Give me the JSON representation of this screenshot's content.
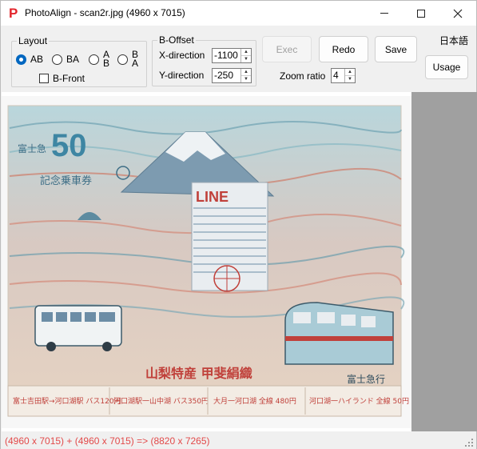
{
  "window": {
    "title": "PhotoAlign - scan2r.jpg (4960 x 7015)",
    "app_icon_letter": "P",
    "accent": "#e3242b"
  },
  "layout": {
    "legend": "Layout",
    "options": [
      {
        "label": "AB",
        "checked": true
      },
      {
        "label": "BA",
        "checked": false
      },
      {
        "label_top": "A",
        "label_bottom": "B",
        "checked": false
      },
      {
        "label_top": "B",
        "label_bottom": "A",
        "checked": false
      }
    ],
    "bfront_label": "B-Front",
    "bfront_checked": false
  },
  "offset": {
    "legend": "B-Offset",
    "x_label": "X-direction",
    "x_value": "-1100",
    "y_label": "Y-direction",
    "y_value": "-250"
  },
  "toolbar": {
    "exec_label": "Exec",
    "redo_label": "Redo",
    "save_label": "Save",
    "usage_label": "Usage",
    "zoom_label": "Zoom ratio",
    "zoom_value": "4",
    "language_label": "日本語"
  },
  "poster": {
    "big_number": "50",
    "headline_top": "富士急",
    "headline_bottom": "記念乗車券",
    "building_sign": "LINE",
    "center_title": "山梨特産 甲斐絹織",
    "brand": "富士急行",
    "routes": [
      "富士吉田駅→河口湖駅 バス120円",
      "河口湖駅一山中湖 バス350円",
      "大月一河口湖 全線 480円",
      "河口湖一ハイランド 全線 50円"
    ]
  },
  "status": {
    "text": "(4960 x 7015) + (4960 x 7015) => (8820 x 7265)",
    "color": "#e24a4a"
  }
}
